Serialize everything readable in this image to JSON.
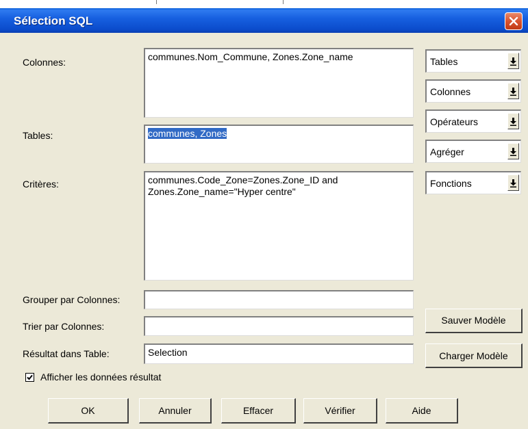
{
  "window": {
    "title": "Sélection SQL"
  },
  "labels": {
    "colonnes": "Colonnes:",
    "tables": "Tables:",
    "criteres": "Critères:",
    "grouper": "Grouper par Colonnes:",
    "trier": "Trier par Colonnes:",
    "resultat": "Résultat dans Table:"
  },
  "fields": {
    "colonnes": "communes.Nom_Commune, Zones.Zone_name",
    "tables": "communes, Zones",
    "criteres": "communes.Code_Zone=Zones.Zone_ID and\nZones.Zone_name=\"Hyper centre\"",
    "grouper": "",
    "trier": "",
    "resultat": "Selection"
  },
  "dropdowns": {
    "tables": "Tables",
    "colonnes": "Colonnes",
    "operateurs": "Opérateurs",
    "agreger": "Agréger",
    "fonctions": "Fonctions"
  },
  "side_buttons": {
    "sauver": "Sauver Modèle",
    "charger": "Charger Modèle"
  },
  "checkbox": {
    "label": "Afficher les données résultat",
    "checked": true
  },
  "bottom_buttons": {
    "ok": "OK",
    "annuler": "Annuler",
    "effacer": "Effacer",
    "verifier": "Vérifier",
    "aide": "Aide"
  }
}
